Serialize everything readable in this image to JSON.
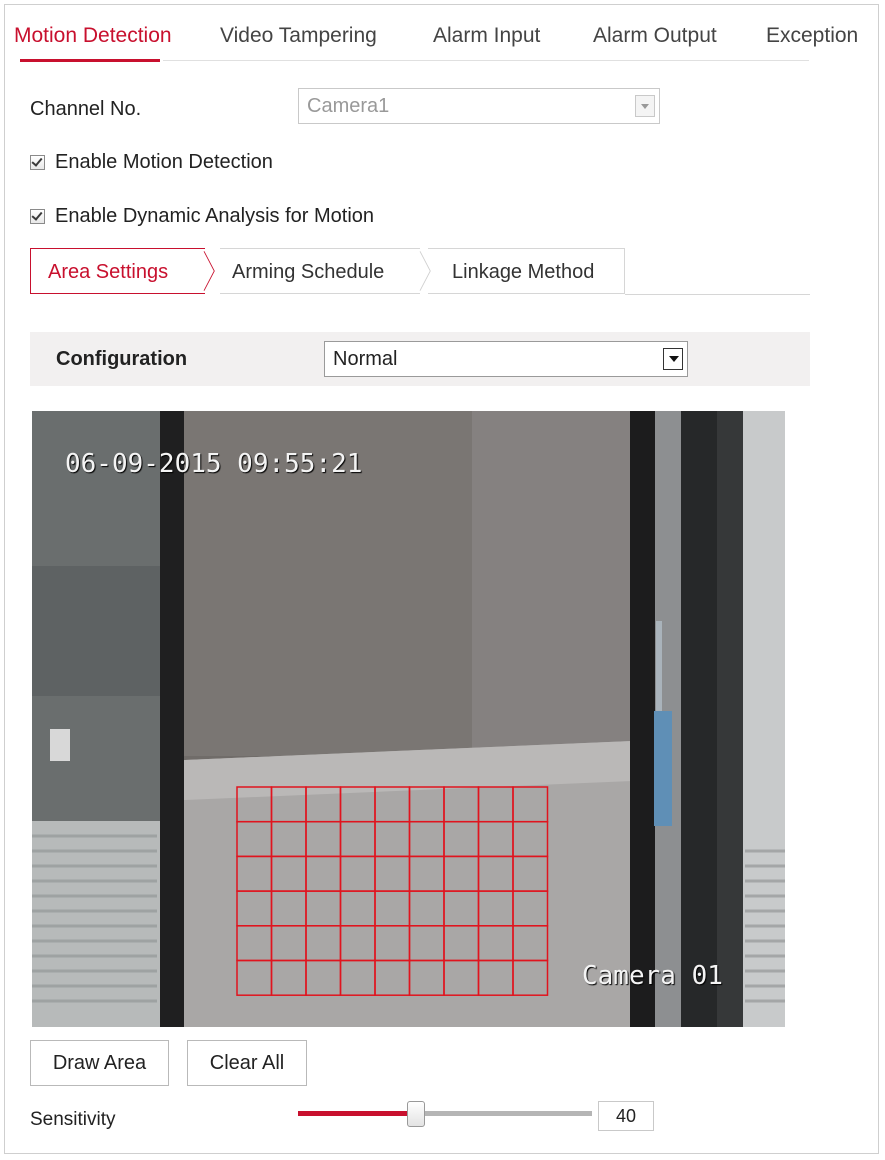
{
  "top_tabs": [
    {
      "label": "Motion Detection",
      "active": true
    },
    {
      "label": "Video Tampering",
      "active": false
    },
    {
      "label": "Alarm Input",
      "active": false
    },
    {
      "label": "Alarm Output",
      "active": false
    },
    {
      "label": "Exception",
      "active": false
    }
  ],
  "channel": {
    "label": "Channel No.",
    "value": "Camera1"
  },
  "checkboxes": {
    "motion_detection": {
      "label": "Enable Motion Detection",
      "checked": true
    },
    "dynamic_analysis": {
      "label": "Enable Dynamic Analysis for Motion",
      "checked": true
    }
  },
  "sub_tabs": [
    {
      "label": "Area Settings",
      "active": true
    },
    {
      "label": "Arming Schedule",
      "active": false
    },
    {
      "label": "Linkage Method",
      "active": false
    }
  ],
  "configuration": {
    "label": "Configuration",
    "value": "Normal"
  },
  "video": {
    "timestamp": "06-09-2015 09:55:21",
    "camera_name": "Camera 01",
    "grid_color": "#e0141e"
  },
  "buttons": {
    "draw_area": "Draw Area",
    "clear_all": "Clear All"
  },
  "sensitivity": {
    "label": "Sensitivity",
    "value": "40",
    "fraction": 0.4
  },
  "colors": {
    "accent": "#c8102e"
  }
}
